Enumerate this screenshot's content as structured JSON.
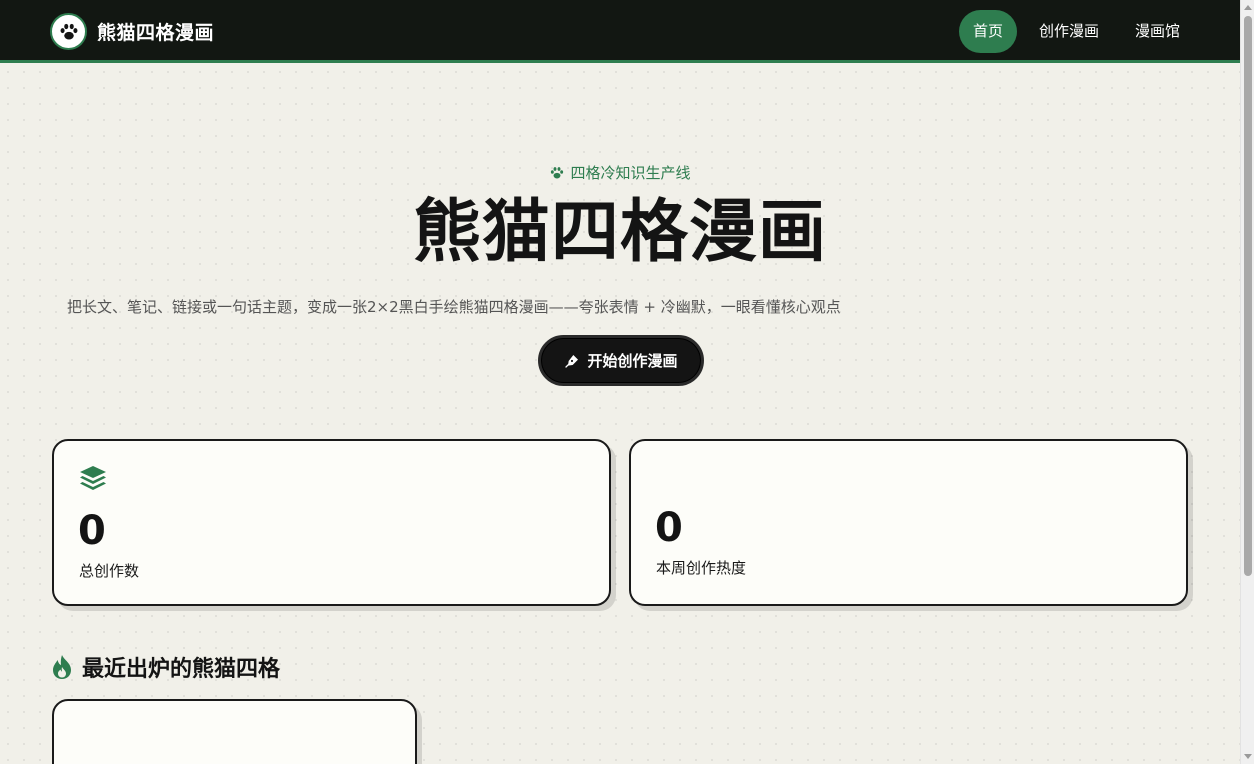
{
  "app": {
    "brand": "熊猫四格漫画"
  },
  "nav": {
    "items": [
      {
        "label": "首页",
        "active": true
      },
      {
        "label": "创作漫画",
        "active": false
      },
      {
        "label": "漫画馆",
        "active": false
      }
    ]
  },
  "hero": {
    "tag": "四格冷知识生产线",
    "title": "熊猫四格漫画",
    "subtitle": "把长文、笔记、链接或一句话主题，变成一张2×2黑白手绘熊猫四格漫画——夸张表情 + 冷幽默，一眼看懂核心观点",
    "cta_label": "开始创作漫画"
  },
  "stats": [
    {
      "value": "0",
      "label": "总创作数",
      "icon": "layers-icon"
    },
    {
      "value": "0",
      "label": "本周创作热度",
      "icon": ""
    }
  ],
  "recent": {
    "title": "最近出炉的熊猫四格",
    "icon": "fire-icon"
  },
  "colors": {
    "accent": "#2e7d4f",
    "nav_bg": "#121712",
    "page_bg": "#f1f0e9",
    "card_bg": "#fdfdf9",
    "ink": "#141414"
  }
}
